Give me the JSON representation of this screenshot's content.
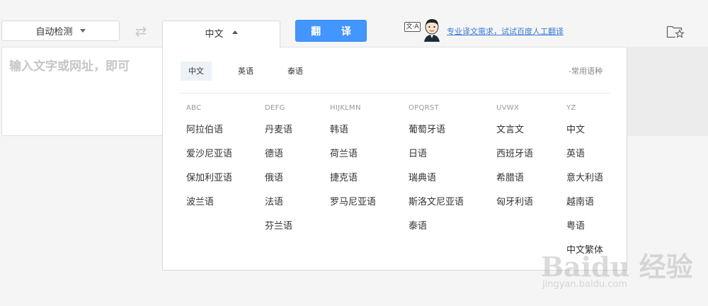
{
  "toolbar": {
    "source_lang": "自动检测",
    "target_lang": "中文",
    "translate_label": "翻 译",
    "human_badge": "文·A",
    "human_link": "专业译文需求，试试百度人工翻译"
  },
  "input": {
    "placeholder": "输入文字或网址，即可"
  },
  "panel": {
    "recent": [
      "中文",
      "英语",
      "泰语"
    ],
    "common_label": "-常用语种",
    "columns": [
      {
        "head": "ABC",
        "items": [
          "阿拉伯语",
          "爱沙尼亚语",
          "保加利亚语",
          "波兰语"
        ]
      },
      {
        "head": "DEFG",
        "items": [
          "丹麦语",
          "德语",
          "俄语",
          "法语",
          "芬兰语"
        ]
      },
      {
        "head": "HIJKLMN",
        "items": [
          "韩语",
          "荷兰语",
          "捷克语",
          "罗马尼亚语"
        ]
      },
      {
        "head": "OPQRST",
        "items": [
          "葡萄牙语",
          "日语",
          "瑞典语",
          "斯洛文尼亚语",
          "泰语"
        ]
      },
      {
        "head": "UVWX",
        "items": [
          "文言文",
          "西班牙语",
          "希腊语",
          "匈牙利语"
        ]
      },
      {
        "head": "YZ",
        "items": [
          "中文",
          "英语",
          "意大利语",
          "越南语",
          "粤语",
          "中文繁体"
        ]
      }
    ]
  },
  "watermark": {
    "text": "Baidu 经验",
    "url": "jingyan.baidu.com"
  },
  "colors": {
    "accent": "#4395ff",
    "link": "#3a7bd5",
    "background": "#f5f5f5"
  },
  "icons": [
    "chevron-down-icon",
    "swap-icon",
    "caret-up-icon",
    "avatar-icon",
    "folder-star-icon"
  ]
}
